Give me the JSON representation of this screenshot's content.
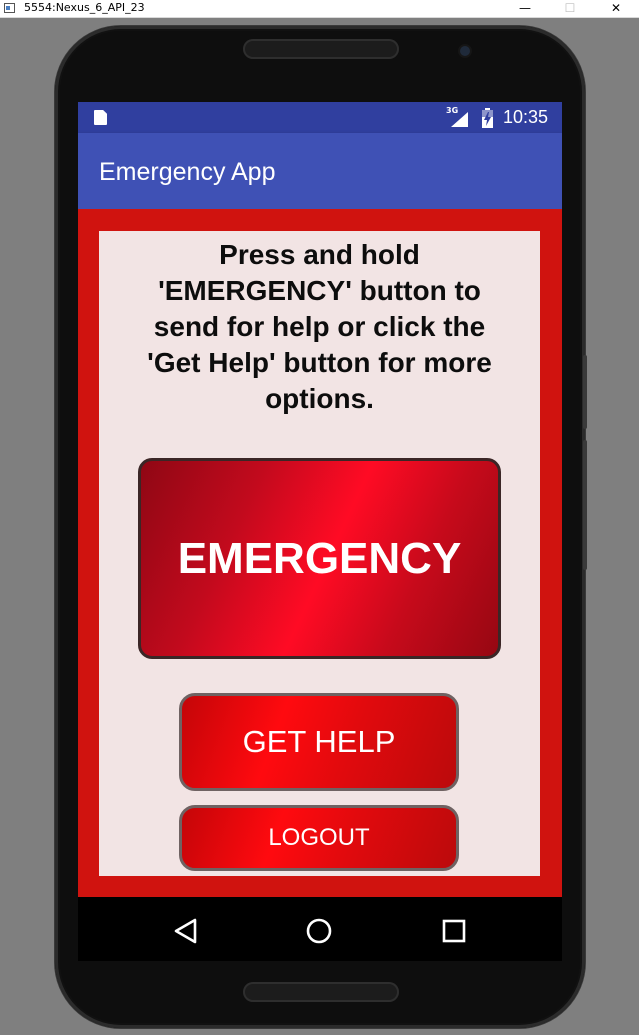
{
  "window": {
    "title": "5554:Nexus_6_API_23",
    "minimize_label": "—",
    "maximize_label": "☐",
    "close_label": "✕"
  },
  "status_bar": {
    "network_type": "3G",
    "time": "10:35",
    "icons": [
      "sd-card-icon",
      "signal-icon",
      "battery-charging-icon"
    ]
  },
  "app_bar": {
    "title": "Emergency App"
  },
  "main": {
    "instructions": "Press and hold 'EMERGENCY' button to send for help or click the 'Get Help' button for more options.",
    "emergency_button_label": "EMERGENCY",
    "get_help_button_label": "GET HELP",
    "logout_button_label": "LOGOUT"
  },
  "nav_bar": {
    "keys": [
      "back-icon",
      "home-icon",
      "recents-icon"
    ]
  },
  "colors": {
    "status_bar": "#303f9f",
    "app_bar": "#3f51b5",
    "content_background": "#d0130f",
    "panel_background": "#f2e4e4",
    "button_red": "#ff0a0f"
  }
}
